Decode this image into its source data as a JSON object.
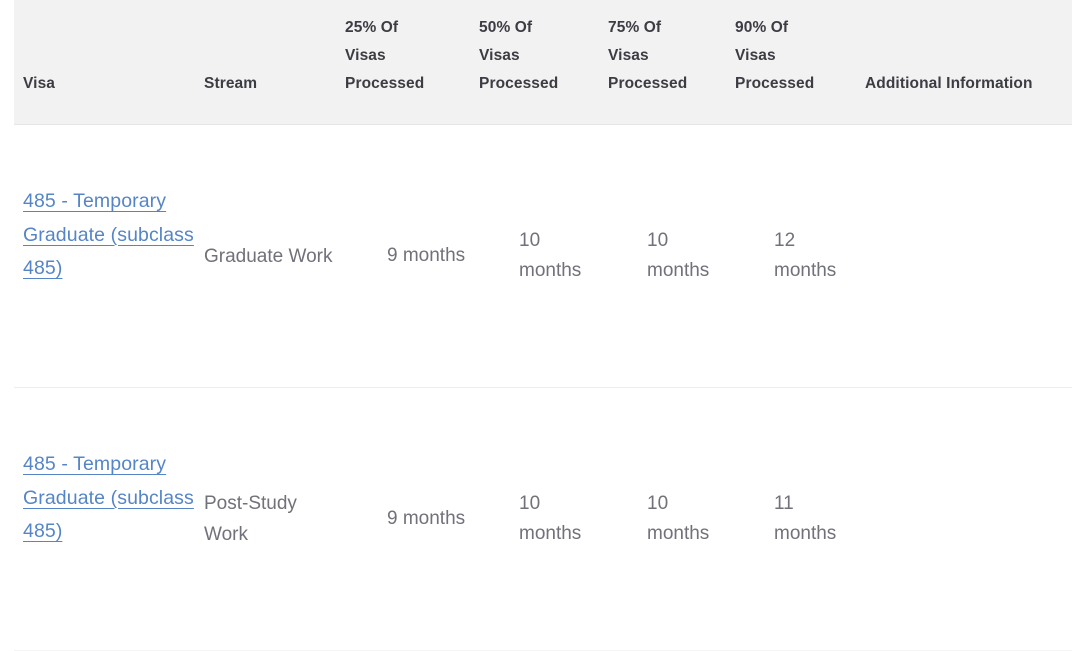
{
  "table": {
    "name": "visa-processing-times-table",
    "columns": [
      {
        "key": "visa",
        "label": "Visa"
      },
      {
        "key": "stream",
        "label": "Stream"
      },
      {
        "key": "p25",
        "label": "25% Of\nVisas\nProcessed"
      },
      {
        "key": "p50",
        "label": "50% Of\nVisas\nProcessed"
      },
      {
        "key": "p75",
        "label": "75% Of\nVisas\nProcessed"
      },
      {
        "key": "p90",
        "label": "90% Of\nVisas\nProcessed"
      },
      {
        "key": "additional",
        "label": "Additional Information"
      }
    ],
    "rows": [
      {
        "visa_link_text": "485 - Temporary Graduate (subclass 485)",
        "stream": "Graduate Work",
        "p25": "9 months",
        "p50": "10 months",
        "p75": "10 months",
        "p90": "12 months",
        "additional": ""
      },
      {
        "visa_link_text": "485 - Temporary Graduate (subclass 485)",
        "stream": "Post-Study Work",
        "p25": "9 months",
        "p50": "10 months",
        "p75": "10 months",
        "p90": "11 months",
        "additional": ""
      }
    ]
  },
  "colors": {
    "header_background": "#f2f2f3",
    "header_text": "#3c3c43",
    "body_text": "#71717a",
    "link": "#5585c7",
    "row_divider": "#ededee",
    "page_background": "#ffffff"
  }
}
